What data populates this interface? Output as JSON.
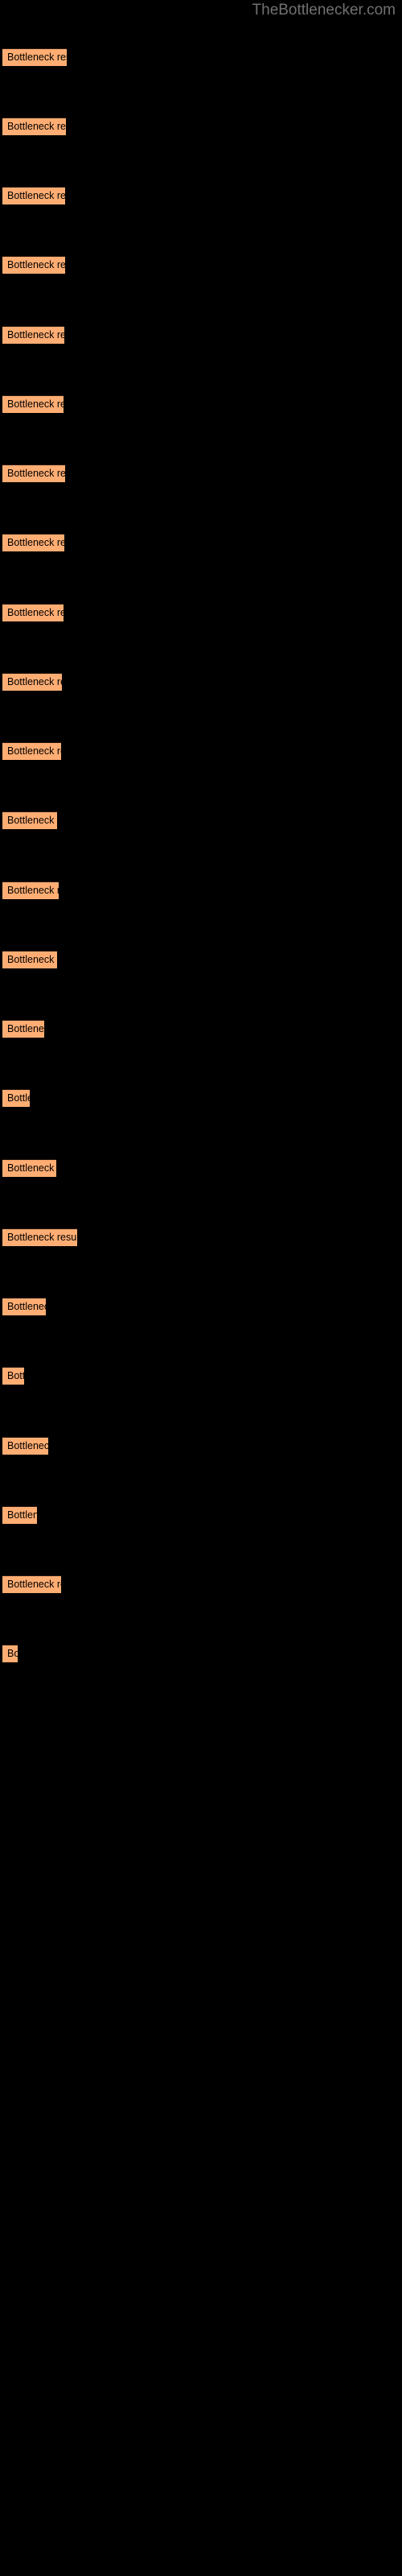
{
  "watermark": {
    "text": "TheBottlenecker.com",
    "color": "#717171"
  },
  "theme": {
    "background": "#000000",
    "bar_color": "#ffad73",
    "bar_label_color": "#000000",
    "bar_border_color": "#2a1a10"
  },
  "chart_data": {
    "type": "bar",
    "orientation": "horizontal",
    "title": "TheBottlenecker.com",
    "subtitle": "",
    "xlabel": "",
    "ylabel": "",
    "grid": false,
    "legend": false,
    "axis_visible": false,
    "tick_labels": [],
    "bar_label_text": "Bottleneck result",
    "xlim": [
      0,
      500
    ],
    "categories": [
      "Bottleneck result",
      "Bottleneck result",
      "Bottleneck result",
      "Bottleneck result",
      "Bottleneck result",
      "Bottleneck result",
      "Bottleneck result",
      "Bottleneck result",
      "Bottleneck result",
      "Bottleneck result",
      "Bottleneck result",
      "Bottleneck result",
      "Bottleneck result",
      "Bottleneck result",
      "Bottleneck result",
      "Bottleneck result",
      "Bottleneck result",
      "Bottleneck result",
      "Bottleneck result",
      "Bottleneck result",
      "Bottleneck result",
      "Bottleneck result",
      "Bottleneck result",
      "Bottleneck result"
    ],
    "values": [
      80,
      79,
      78,
      78,
      77,
      76,
      78,
      77,
      76,
      74,
      73,
      68,
      70,
      68,
      52,
      34,
      67,
      93,
      54,
      27,
      57,
      43,
      73,
      19
    ]
  },
  "bars": [
    {
      "label": "Bottleneck result",
      "width": 80,
      "top": 60
    },
    {
      "label": "Bottleneck result",
      "width": 79,
      "top": 146
    },
    {
      "label": "Bottleneck result",
      "width": 78,
      "top": 232
    },
    {
      "label": "Bottleneck result",
      "width": 78,
      "top": 318
    },
    {
      "label": "Bottleneck result",
      "width": 77,
      "top": 405
    },
    {
      "label": "Bottleneck result",
      "width": 76,
      "top": 491
    },
    {
      "label": "Bottleneck result",
      "width": 78,
      "top": 577
    },
    {
      "label": "Bottleneck result",
      "width": 77,
      "top": 663
    },
    {
      "label": "Bottleneck result",
      "width": 76,
      "top": 750
    },
    {
      "label": "Bottleneck result",
      "width": 74,
      "top": 836
    },
    {
      "label": "Bottleneck result",
      "width": 73,
      "top": 922
    },
    {
      "label": "Bottleneck result",
      "width": 68,
      "top": 1008
    },
    {
      "label": "Bottleneck result",
      "width": 70,
      "top": 1095
    },
    {
      "label": "Bottleneck result",
      "width": 68,
      "top": 1181
    },
    {
      "label": "Bottleneck result",
      "width": 52,
      "top": 1267
    },
    {
      "label": "Bottleneck result",
      "width": 34,
      "top": 1353
    },
    {
      "label": "Bottleneck result",
      "width": 67,
      "top": 1440
    },
    {
      "label": "Bottleneck result",
      "width": 93,
      "top": 1526
    },
    {
      "label": "Bottleneck result",
      "width": 54,
      "top": 1612
    },
    {
      "label": "Bottleneck result",
      "width": 27,
      "top": 1698
    },
    {
      "label": "Bottleneck result",
      "width": 57,
      "top": 1785
    },
    {
      "label": "Bottleneck result",
      "width": 43,
      "top": 1871
    },
    {
      "label": "Bottleneck result",
      "width": 73,
      "top": 1957
    },
    {
      "label": "Bottleneck result",
      "width": 19,
      "top": 2043
    }
  ]
}
